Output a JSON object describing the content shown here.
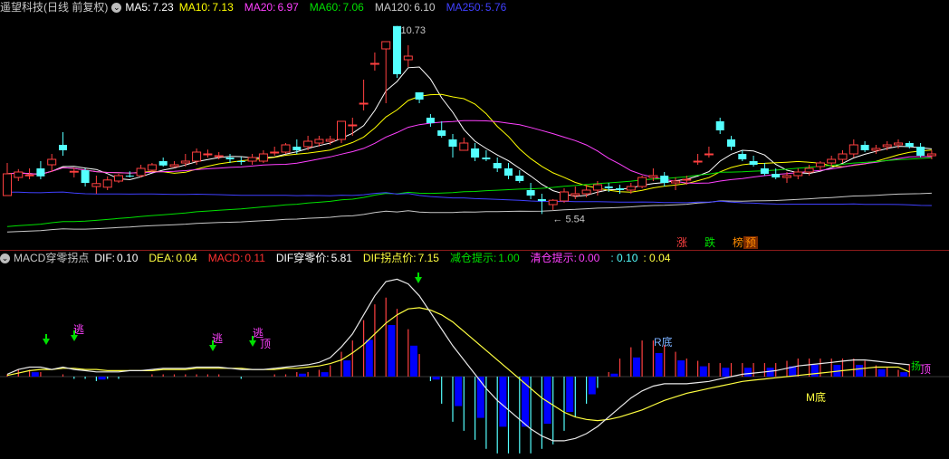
{
  "top_header": {
    "stock": "遥望科技(日线 前复权)",
    "ma5_label": "MA5:",
    "ma5": "7.23",
    "ma10_label": "MA10:",
    "ma10": "7.13",
    "ma20_label": "MA20:",
    "ma20": "6.97",
    "ma60_label": "MA60:",
    "ma60": "7.06",
    "ma120_label": "MA120:",
    "ma120": "6.10",
    "ma250_label": "MA250:",
    "ma250": "5.76"
  },
  "bottom_header": {
    "name": "MACD穿零拐点",
    "dif_label": "DIF:",
    "dif": "0.10",
    "dea_label": "DEA:",
    "dea": "0.04",
    "macd_label": "MACD:",
    "macd": "0.11",
    "cross_label": "DIF穿零价:",
    "cross": "5.81",
    "turn_label": "DIF拐点价:",
    "turn": "7.15",
    "reduce_label": "减仓提示:",
    "reduce": "1.00",
    "clear_label": "清仓提示:",
    "clear": "0.00",
    "extra1": ": 0.10",
    "extra2": ": 0.04"
  },
  "buttons": {
    "rise": "涨",
    "fall": "跌",
    "rank": "榜",
    "pre": "预"
  },
  "annotations": {
    "high": "10.73",
    "low": "5.54",
    "escape": "逃",
    "top": "顶",
    "r_bottom": "R底",
    "m_bottom": "M底",
    "top2": "顶",
    "z_mark": "扬"
  },
  "colors": {
    "ma5": "#ffffff",
    "ma10": "#ffff00",
    "ma20": "#ff40ff",
    "ma60": "#00e000",
    "ma120": "#c8c8c8",
    "ma250": "#4040ff",
    "up": "#ff4040",
    "down": "#54ffff",
    "dif": "#e8e8e8",
    "dea": "#ffff40",
    "macd_pos": "#ff4040",
    "macd_neg": "#54ffff",
    "hist_pos": "#0000ff",
    "hist_neg": "#0000ff"
  },
  "chart_data": [
    {
      "type": "candlestick",
      "title": "遥望科技(日线 前复权)",
      "series": [
        {
          "name": "K",
          "ohlc": [
            [
              6.05,
              6.95,
              6.05,
              6.65
            ],
            [
              6.55,
              6.78,
              6.45,
              6.7
            ],
            [
              6.6,
              6.8,
              6.5,
              6.62
            ],
            [
              6.8,
              7.0,
              6.5,
              6.58
            ],
            [
              6.9,
              7.2,
              6.7,
              7.05
            ],
            [
              7.45,
              7.8,
              7.15,
              7.3
            ],
            [
              6.7,
              6.82,
              6.55,
              6.72
            ],
            [
              6.75,
              6.8,
              6.3,
              6.4
            ],
            [
              6.3,
              6.6,
              6.1,
              6.38
            ],
            [
              6.28,
              6.58,
              6.2,
              6.48
            ],
            [
              6.45,
              6.65,
              6.4,
              6.6
            ],
            [
              6.6,
              6.72,
              6.55,
              6.58
            ],
            [
              6.6,
              6.9,
              6.55,
              6.8
            ],
            [
              6.75,
              6.95,
              6.7,
              6.9
            ],
            [
              7.0,
              7.1,
              6.85,
              6.88
            ],
            [
              6.85,
              7.0,
              6.82,
              6.9
            ],
            [
              6.95,
              7.2,
              6.85,
              7.0
            ],
            [
              7.0,
              7.35,
              6.9,
              7.25
            ],
            [
              7.2,
              7.32,
              7.1,
              7.2
            ],
            [
              7.15,
              7.25,
              7.05,
              7.15
            ],
            [
              7.1,
              7.2,
              6.95,
              7.05
            ],
            [
              7.0,
              7.12,
              6.9,
              6.98
            ],
            [
              7.0,
              7.2,
              6.9,
              7.1
            ],
            [
              7.0,
              7.3,
              6.95,
              7.2
            ],
            [
              7.25,
              7.4,
              7.15,
              7.25
            ],
            [
              7.25,
              7.5,
              7.2,
              7.45
            ],
            [
              7.4,
              7.6,
              7.2,
              7.3
            ],
            [
              7.4,
              7.7,
              7.3,
              7.55
            ],
            [
              7.5,
              7.7,
              7.4,
              7.6
            ],
            [
              7.55,
              7.7,
              7.45,
              7.6
            ],
            [
              7.6,
              8.1,
              7.5,
              8.1
            ],
            [
              8.0,
              8.2,
              7.7,
              8.0
            ],
            [
              8.6,
              9.25,
              8.4,
              8.6
            ],
            [
              9.7,
              10.0,
              9.5,
              9.7
            ],
            [
              10.1,
              10.3,
              8.6,
              10.3
            ],
            [
              10.73,
              10.73,
              9.3,
              9.4
            ],
            [
              9.8,
              10.2,
              9.6,
              9.9
            ],
            [
              8.9,
              8.9,
              8.6,
              8.7
            ],
            [
              8.2,
              8.3,
              7.95,
              8.05
            ],
            [
              7.85,
              8.1,
              7.65,
              7.7
            ],
            [
              7.6,
              7.75,
              7.1,
              7.4
            ],
            [
              7.3,
              7.65,
              7.3,
              7.5
            ],
            [
              7.35,
              7.5,
              7.0,
              7.1
            ],
            [
              7.1,
              7.3,
              7.0,
              7.05
            ],
            [
              6.95,
              7.1,
              6.7,
              6.8
            ],
            [
              6.8,
              6.95,
              6.5,
              6.6
            ],
            [
              6.6,
              6.75,
              6.4,
              6.45
            ],
            [
              6.2,
              6.4,
              5.95,
              6.05
            ],
            [
              5.95,
              6.1,
              5.54,
              5.9
            ],
            [
              5.8,
              5.95,
              5.65,
              5.92
            ],
            [
              5.9,
              6.25,
              5.85,
              6.15
            ],
            [
              6.05,
              6.3,
              5.95,
              6.1
            ],
            [
              6.1,
              6.35,
              6.0,
              6.2
            ],
            [
              6.2,
              6.45,
              6.05,
              6.35
            ],
            [
              6.3,
              6.4,
              6.15,
              6.25
            ],
            [
              6.25,
              6.35,
              6.1,
              6.2
            ],
            [
              6.2,
              6.4,
              6.1,
              6.3
            ],
            [
              6.3,
              6.6,
              6.25,
              6.55
            ],
            [
              6.55,
              6.8,
              6.45,
              6.6
            ],
            [
              6.6,
              6.7,
              6.3,
              6.4
            ],
            [
              6.4,
              6.55,
              6.2,
              6.45
            ],
            [
              6.5,
              6.6,
              6.35,
              6.5
            ],
            [
              7.0,
              7.2,
              6.9,
              7.0
            ],
            [
              7.2,
              7.4,
              7.1,
              7.2
            ],
            [
              8.1,
              8.2,
              7.75,
              7.85
            ],
            [
              7.6,
              7.7,
              7.3,
              7.4
            ],
            [
              7.2,
              7.3,
              7.0,
              7.05
            ],
            [
              7.0,
              7.15,
              6.85,
              6.9
            ],
            [
              6.8,
              6.95,
              6.6,
              6.65
            ],
            [
              6.65,
              6.8,
              6.5,
              6.55
            ],
            [
              6.55,
              6.7,
              6.4,
              6.6
            ],
            [
              6.6,
              6.8,
              6.5,
              6.7
            ],
            [
              6.7,
              6.9,
              6.6,
              6.8
            ],
            [
              6.85,
              7.0,
              6.75,
              6.95
            ],
            [
              6.95,
              7.15,
              6.85,
              7.05
            ],
            [
              7.05,
              7.3,
              6.95,
              7.2
            ],
            [
              7.2,
              7.6,
              7.1,
              7.45
            ],
            [
              7.45,
              7.55,
              7.25,
              7.3
            ],
            [
              7.3,
              7.45,
              7.2,
              7.35
            ],
            [
              7.4,
              7.55,
              7.3,
              7.45
            ],
            [
              7.45,
              7.6,
              7.35,
              7.5
            ],
            [
              7.5,
              7.55,
              7.35,
              7.4
            ],
            [
              7.4,
              7.5,
              7.1,
              7.15
            ],
            [
              7.15,
              7.3,
              7.05,
              7.2
            ]
          ]
        }
      ],
      "ma_labels": [
        "MA5",
        "MA10",
        "MA20",
        "MA60",
        "MA120",
        "MA250"
      ],
      "ylim": [
        5.0,
        11.0
      ]
    },
    {
      "type": "bar",
      "title": "MACD穿零拐点",
      "series": [
        {
          "name": "DIF",
          "values": [
            0.02,
            0.06,
            0.08,
            0.08,
            0.06,
            0.08,
            0.06,
            0.05,
            0.04,
            0.04,
            0.04,
            0.05,
            0.05,
            0.06,
            0.07,
            0.07,
            0.07,
            0.08,
            0.08,
            0.08,
            0.07,
            0.06,
            0.06,
            0.06,
            0.07,
            0.08,
            0.09,
            0.1,
            0.12,
            0.16,
            0.25,
            0.36,
            0.52,
            0.68,
            0.8,
            0.82,
            0.78,
            0.68,
            0.54,
            0.4,
            0.26,
            0.14,
            0.02,
            -0.1,
            -0.2,
            -0.28,
            -0.36,
            -0.44,
            -0.5,
            -0.54,
            -0.54,
            -0.52,
            -0.48,
            -0.42,
            -0.34,
            -0.26,
            -0.18,
            -0.12,
            -0.08,
            -0.06,
            -0.06,
            -0.06,
            -0.05,
            -0.04,
            -0.02,
            0.0,
            0.02,
            0.03,
            0.04,
            0.05,
            0.07,
            0.09,
            0.1,
            0.11,
            0.12,
            0.13,
            0.14,
            0.14,
            0.13,
            0.12,
            0.11,
            0.1
          ]
        },
        {
          "name": "DEA",
          "values": [
            0.01,
            0.03,
            0.05,
            0.06,
            0.06,
            0.07,
            0.07,
            0.06,
            0.06,
            0.05,
            0.05,
            0.05,
            0.05,
            0.05,
            0.06,
            0.06,
            0.06,
            0.07,
            0.07,
            0.07,
            0.07,
            0.07,
            0.06,
            0.06,
            0.06,
            0.07,
            0.07,
            0.08,
            0.09,
            0.11,
            0.14,
            0.2,
            0.27,
            0.36,
            0.45,
            0.52,
            0.57,
            0.58,
            0.56,
            0.52,
            0.46,
            0.38,
            0.3,
            0.22,
            0.14,
            0.06,
            -0.02,
            -0.1,
            -0.18,
            -0.24,
            -0.3,
            -0.34,
            -0.36,
            -0.37,
            -0.36,
            -0.34,
            -0.31,
            -0.28,
            -0.24,
            -0.2,
            -0.17,
            -0.14,
            -0.12,
            -0.1,
            -0.08,
            -0.06,
            -0.04,
            -0.03,
            -0.02,
            -0.01,
            0.0,
            0.01,
            0.02,
            0.03,
            0.04,
            0.05,
            0.06,
            0.07,
            0.08,
            0.08,
            0.08,
            0.04
          ]
        },
        {
          "name": "MACD",
          "values": [
            0.02,
            0.06,
            0.06,
            0.04,
            0.0,
            0.02,
            -0.02,
            -0.02,
            -0.04,
            -0.02,
            -0.02,
            0.0,
            0.0,
            0.02,
            0.02,
            0.02,
            0.02,
            0.02,
            0.02,
            0.02,
            0.0,
            -0.02,
            0.0,
            0.0,
            0.02,
            0.02,
            0.04,
            0.04,
            0.06,
            0.1,
            0.22,
            0.32,
            0.5,
            0.64,
            0.7,
            0.6,
            0.42,
            0.2,
            -0.04,
            -0.24,
            -0.4,
            -0.48,
            -0.56,
            -0.64,
            -0.68,
            -0.68,
            -0.68,
            -0.68,
            -0.64,
            -0.6,
            -0.48,
            -0.36,
            -0.24,
            -0.1,
            0.04,
            0.16,
            0.26,
            0.32,
            0.32,
            0.28,
            0.22,
            0.16,
            0.14,
            0.12,
            0.12,
            0.12,
            0.12,
            0.12,
            0.12,
            0.12,
            0.14,
            0.16,
            0.16,
            0.16,
            0.16,
            0.16,
            0.16,
            0.14,
            0.1,
            0.08,
            0.06,
            0.11
          ]
        }
      ],
      "ylim": [
        -0.9,
        0.9
      ]
    }
  ]
}
